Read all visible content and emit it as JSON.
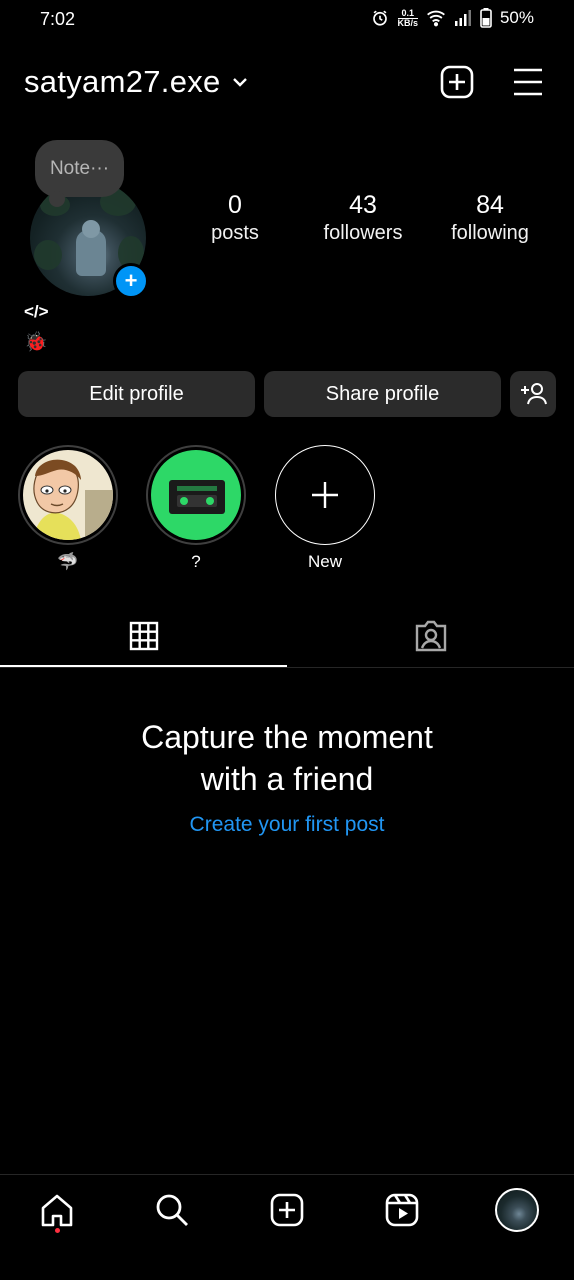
{
  "status_bar": {
    "time": "7:02",
    "net_speed_value": "0.1",
    "net_speed_unit": "KB/s",
    "battery": "50%"
  },
  "header": {
    "username": "satyam27.exe",
    "icons": [
      "chevron-down-icon",
      "add-square-icon",
      "menu-icon"
    ]
  },
  "profile": {
    "note": "Note···",
    "stats": [
      {
        "value": "0",
        "label": "posts"
      },
      {
        "value": "43",
        "label": "followers"
      },
      {
        "value": "84",
        "label": "following"
      }
    ],
    "bio_line1": "</>",
    "bio_line2": "🐞"
  },
  "actions": {
    "edit_label": "Edit profile",
    "share_label": "Share profile"
  },
  "highlights": [
    {
      "label": "🦈"
    },
    {
      "label": "?"
    },
    {
      "label": "New"
    }
  ],
  "tabs": [
    "grid-icon",
    "tagged-icon"
  ],
  "empty_state": {
    "title_line1": "Capture the moment",
    "title_line2": "with a friend",
    "link": "Create your first post"
  },
  "colors": {
    "accent_blue": "#0095f6",
    "link_blue": "#2196f3",
    "button_bg": "#2b2b2b",
    "spotify_green": "#2dd867",
    "notification_dot": "#ff3040"
  },
  "bottom_nav": [
    "home-icon",
    "search-icon",
    "create-icon",
    "reels-icon",
    "profile-avatar"
  ]
}
